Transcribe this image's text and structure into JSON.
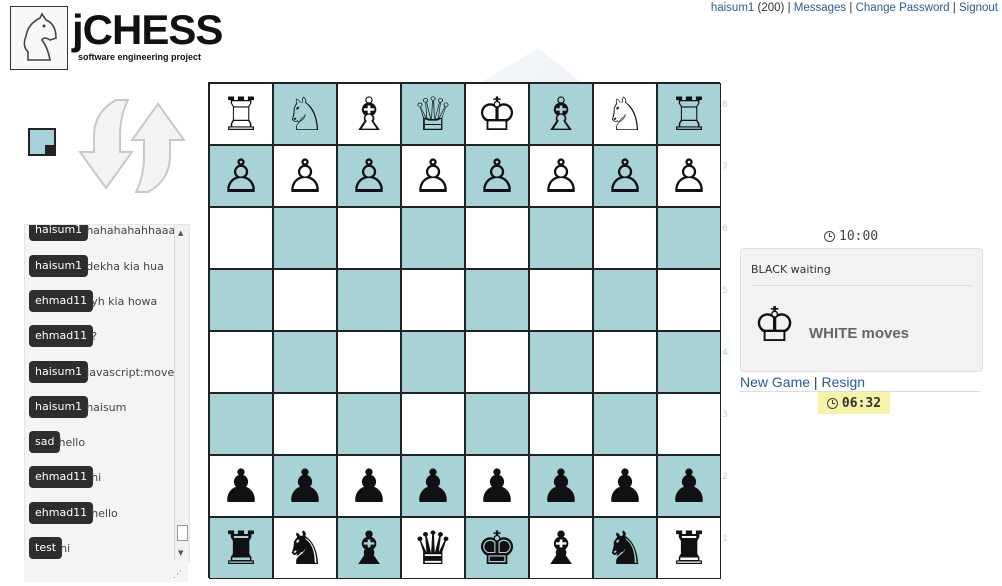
{
  "branding": {
    "title": "jCHESS",
    "subtitle": "software engineering project",
    "logo_icon": "knight-sketch-icon"
  },
  "user_nav": {
    "username": "haisum1",
    "rating": "(200)",
    "separator": "|",
    "messages": "Messages",
    "change_password": "Change Password",
    "signout": "Signout"
  },
  "controls": {
    "flip_icon": "flip-board-arrows-icon",
    "color_swatch": "#a7d2d6"
  },
  "chat": {
    "messages": [
      {
        "user": "haisum1",
        "text": "hahahahahhaaa"
      },
      {
        "user": "haisum1",
        "text": "dekha kia hua"
      },
      {
        "user": "ehmad11",
        "text": "yh kia howa"
      },
      {
        "user": "ehmad11",
        "text": "?"
      },
      {
        "user": "haisum1",
        "text": "javascript:move($"
      },
      {
        "user": "haisum1",
        "text": "haisum"
      },
      {
        "user": "sad",
        "text": "hello"
      },
      {
        "user": "ehmad11",
        "text": "hi"
      },
      {
        "user": "ehmad11",
        "text": "hello"
      },
      {
        "user": "test",
        "text": "hi"
      }
    ]
  },
  "board": {
    "light_color": "#ffffff",
    "dark_color": "#a7d2d6",
    "ranks": [
      "8",
      "7",
      "6",
      "5",
      "4",
      "3",
      "2",
      "1"
    ],
    "rows": [
      [
        "♖",
        "♘",
        "♗",
        "♕",
        "♔",
        "♗",
        "♘",
        "♖"
      ],
      [
        "♙",
        "♙",
        "♙",
        "♙",
        "♙",
        "♙",
        "♙",
        "♙"
      ],
      [
        "",
        "",
        "",
        "",
        "",
        "",
        "",
        ""
      ],
      [
        "",
        "",
        "",
        "",
        "",
        "",
        "",
        ""
      ],
      [
        "",
        "",
        "",
        "",
        "",
        "",
        "",
        ""
      ],
      [
        "",
        "",
        "",
        "",
        "",
        "",
        "",
        ""
      ],
      [
        "♟",
        "♟",
        "♟",
        "♟",
        "♟",
        "♟",
        "♟",
        "♟"
      ],
      [
        "♜",
        "♞",
        "♝",
        "♛",
        "♚",
        "♝",
        "♞",
        "♜"
      ]
    ]
  },
  "game": {
    "black_clock": "10:00",
    "black_status": "BLACK waiting",
    "white_status": "WHITE moves",
    "white_king": "♔",
    "new_game": "New Game",
    "links_separator": "|",
    "resign": "Resign",
    "white_clock": "06:32",
    "clock_icon": "clock-icon"
  }
}
